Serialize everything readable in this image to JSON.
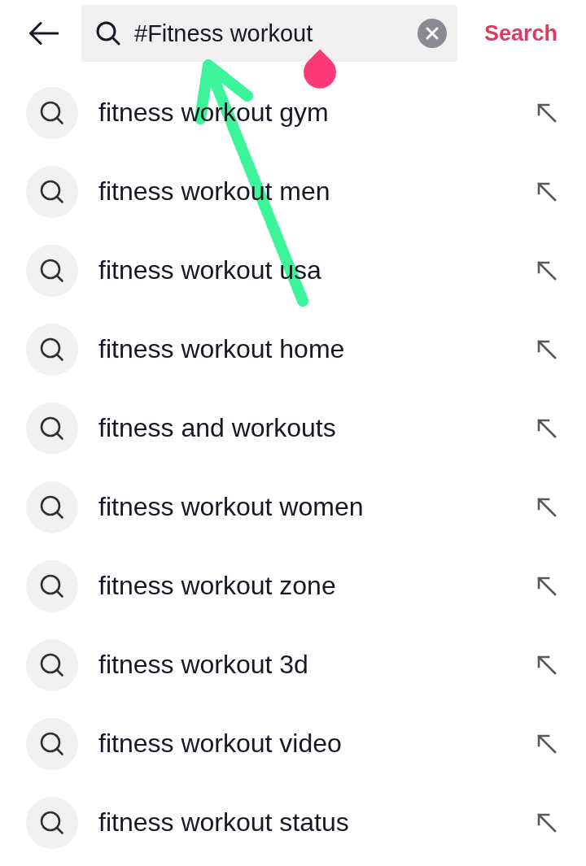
{
  "top_bar": {
    "search_field": {
      "value": "#Fitness workout",
      "focused": true
    },
    "search_button": "Search"
  },
  "suggestions": [
    {
      "text": "fitness workout gym"
    },
    {
      "text": "fitness workout men"
    },
    {
      "text": "fitness workout usa"
    },
    {
      "text": "fitness workout home"
    },
    {
      "text": "fitness and workouts"
    },
    {
      "text": "fitness workout women"
    },
    {
      "text": "fitness workout zone"
    },
    {
      "text": "fitness workout 3d"
    },
    {
      "text": "fitness workout video"
    },
    {
      "text": "fitness workout status"
    }
  ]
}
